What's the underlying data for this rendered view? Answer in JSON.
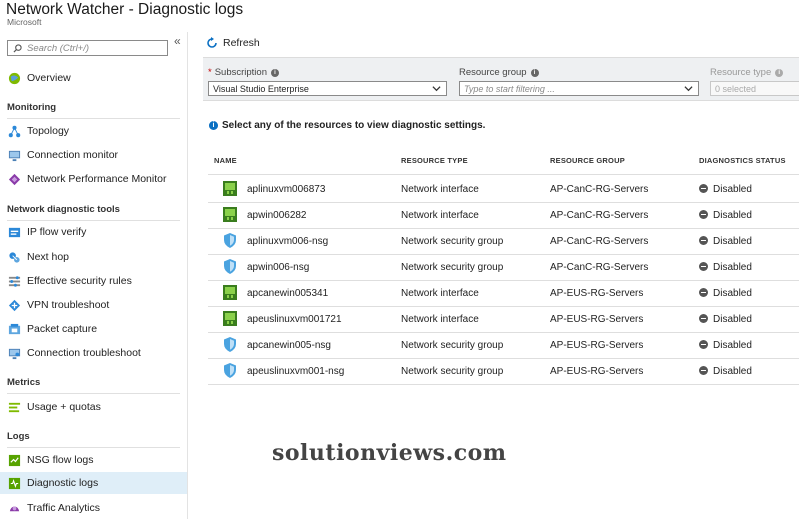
{
  "header": {
    "title": "Network Watcher - Diagnostic logs",
    "subtitle": "Microsoft"
  },
  "sidebar": {
    "search_placeholder": "Search (Ctrl+/)",
    "collapse_glyph": "«",
    "overview": {
      "label": "Overview",
      "icon": "globe-icon"
    },
    "sections": [
      {
        "label": "Monitoring",
        "items": [
          {
            "label": "Topology",
            "icon": "topology-icon"
          },
          {
            "label": "Connection monitor",
            "icon": "monitor-icon"
          },
          {
            "label": "Network Performance Monitor",
            "icon": "diamond-icon"
          }
        ]
      },
      {
        "label": "Network diagnostic tools",
        "items": [
          {
            "label": "IP flow verify",
            "icon": "ip-flow-icon"
          },
          {
            "label": "Next hop",
            "icon": "next-hop-icon"
          },
          {
            "label": "Effective security rules",
            "icon": "security-rules-icon"
          },
          {
            "label": "VPN troubleshoot",
            "icon": "vpn-icon"
          },
          {
            "label": "Packet capture",
            "icon": "packet-capture-icon"
          },
          {
            "label": "Connection troubleshoot",
            "icon": "connection-troubleshoot-icon"
          }
        ]
      },
      {
        "label": "Metrics",
        "items": [
          {
            "label": "Usage + quotas",
            "icon": "usage-icon"
          }
        ]
      },
      {
        "label": "Logs",
        "items": [
          {
            "label": "NSG flow logs",
            "icon": "nsg-flow-icon"
          },
          {
            "label": "Diagnostic logs",
            "icon": "diagnostic-logs-icon",
            "active": true
          },
          {
            "label": "Traffic Analytics",
            "icon": "traffic-analytics-icon"
          }
        ]
      }
    ]
  },
  "toolbar": {
    "refresh_label": "Refresh"
  },
  "filters": {
    "subscription": {
      "label": "Subscription",
      "value": "Visual Studio Enterprise"
    },
    "resource_group": {
      "label": "Resource group",
      "placeholder": "Type to start filtering ..."
    },
    "resource_type": {
      "label": "Resource type",
      "value": "0 selected"
    }
  },
  "hint": "Select any of the resources to view diagnostic settings.",
  "table": {
    "columns": [
      "NAME",
      "RESOURCE TYPE",
      "RESOURCE GROUP",
      "DIAGNOSTICS STATUS"
    ],
    "rows": [
      {
        "name": "aplinuxvm006873",
        "type": "Network interface",
        "group": "AP-CanC-RG-Servers",
        "status": "Disabled",
        "icon": "nic-icon"
      },
      {
        "name": "apwin006282",
        "type": "Network interface",
        "group": "AP-CanC-RG-Servers",
        "status": "Disabled",
        "icon": "nic-icon"
      },
      {
        "name": "aplinuxvm006-nsg",
        "type": "Network security group",
        "group": "AP-CanC-RG-Servers",
        "status": "Disabled",
        "icon": "shield-icon"
      },
      {
        "name": "apwin006-nsg",
        "type": "Network security group",
        "group": "AP-CanC-RG-Servers",
        "status": "Disabled",
        "icon": "shield-icon"
      },
      {
        "name": "apcanewin005341",
        "type": "Network interface",
        "group": "AP-EUS-RG-Servers",
        "status": "Disabled",
        "icon": "nic-icon"
      },
      {
        "name": "apeuslinuxvm001721",
        "type": "Network interface",
        "group": "AP-EUS-RG-Servers",
        "status": "Disabled",
        "icon": "nic-icon"
      },
      {
        "name": "apcanewin005-nsg",
        "type": "Network security group",
        "group": "AP-EUS-RG-Servers",
        "status": "Disabled",
        "icon": "shield-icon"
      },
      {
        "name": "apeuslinuxvm001-nsg",
        "type": "Network security group",
        "group": "AP-EUS-RG-Servers",
        "status": "Disabled",
        "icon": "shield-icon"
      }
    ]
  },
  "watermark": "solutionviews.com"
}
